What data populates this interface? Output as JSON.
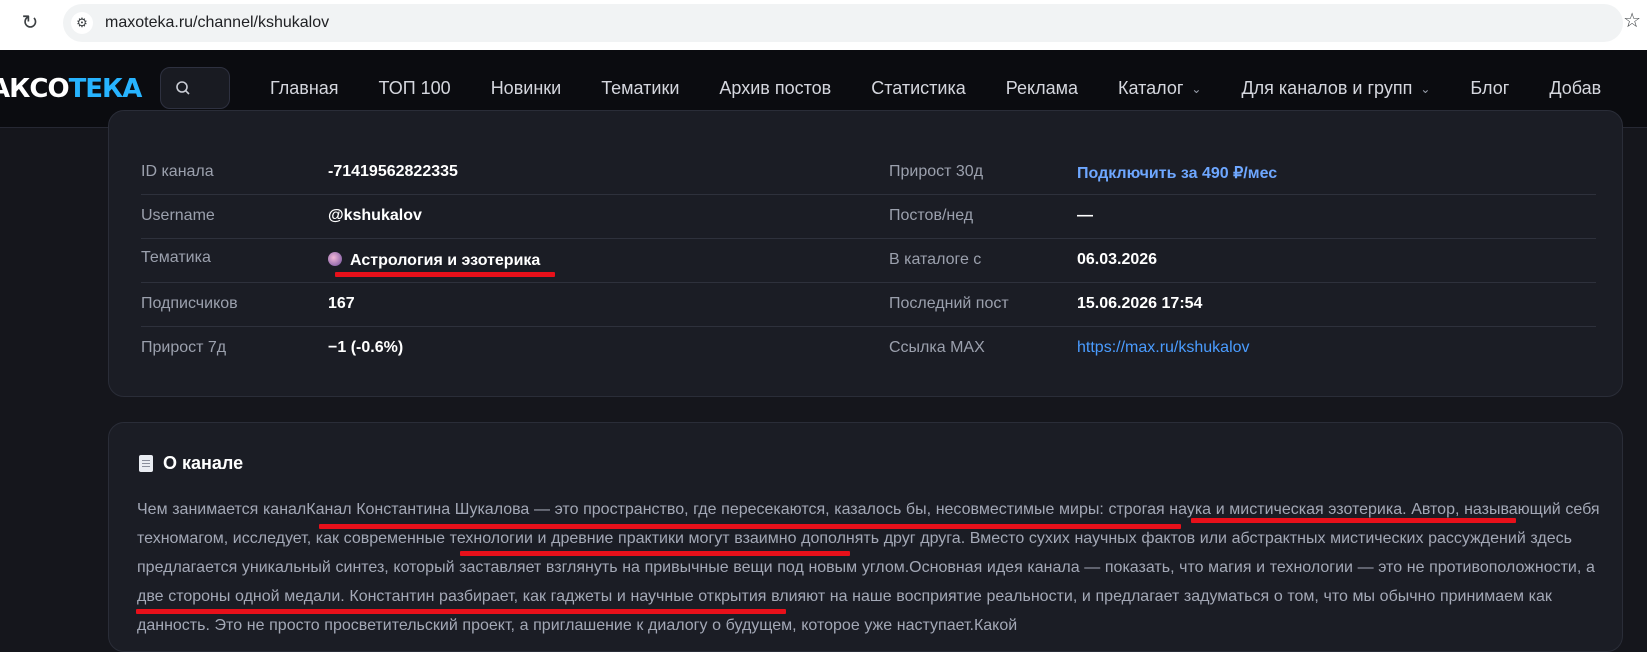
{
  "browser": {
    "url": "maxoteka.ru/channel/kshukalov"
  },
  "site": {
    "logo_part1": "АКСО",
    "logo_part2": "ТЕКА",
    "nav": [
      "Главная",
      "ТОП 100",
      "Новинки",
      "Тематики",
      "Архив постов",
      "Статистика",
      "Реклама",
      "Каталог",
      "Для каналов и групп",
      "Блог",
      "Добав"
    ]
  },
  "info": {
    "left": [
      {
        "label": "ID канала",
        "value": "-71419562822335"
      },
      {
        "label": "Username",
        "value": "@kshukalov"
      },
      {
        "label": "Тематика",
        "value": "Астрология и эзотерика"
      },
      {
        "label": "Подписчиков",
        "value": "167"
      },
      {
        "label": "Прирост 7д",
        "value": "−1 (-0.6%)"
      }
    ],
    "right": [
      {
        "label": "Прирост 30д",
        "value": "Подключить за 490 ₽/мес"
      },
      {
        "label": "Постов/нед",
        "value": "—"
      },
      {
        "label": "В каталоге с",
        "value": "06.03.2026"
      },
      {
        "label": "Последний пост",
        "value": "15.06.2026 17:54"
      },
      {
        "label": "Ссылка MAX",
        "value": "https://max.ru/kshukalov"
      }
    ]
  },
  "about": {
    "title": "О канале",
    "text": "Чем занимается каналКанал Константина Шукалова — это пространство, где пересекаются, казалось бы, несовместимые миры: строгая наука и мистическая эзотерика. Автор, называющий себя техномагом, исследует, как современные технологии и древние практики могут взаимно дополнять друг друга. Вместо сухих научных фактов или абстрактных мистических рассуждений здесь предлагается уникальный синтез, который заставляет взглянуть на привычные вещи под новым углом.Основная идея канала — показать, что магия и технологии — это не противоположности, а две стороны одной медали. Константин разбирает, как гаджеты и научные открытия влияют на наше восприятие реальности, и предлагает задуматься о том, что мы обычно принимаем как данность. Это не просто просветительский проект, а приглашение к диалогу о будущем, которое уже наступает.Какой"
  },
  "colors": {
    "page_bg": "#15161c",
    "nav_bg": "#0b0c10",
    "card_bg": "#1b1d25",
    "logo_accent": "#27b4ff",
    "cta": "#6ea7ff",
    "link": "#4a9cff",
    "highlight_mark": "#e8101a"
  }
}
